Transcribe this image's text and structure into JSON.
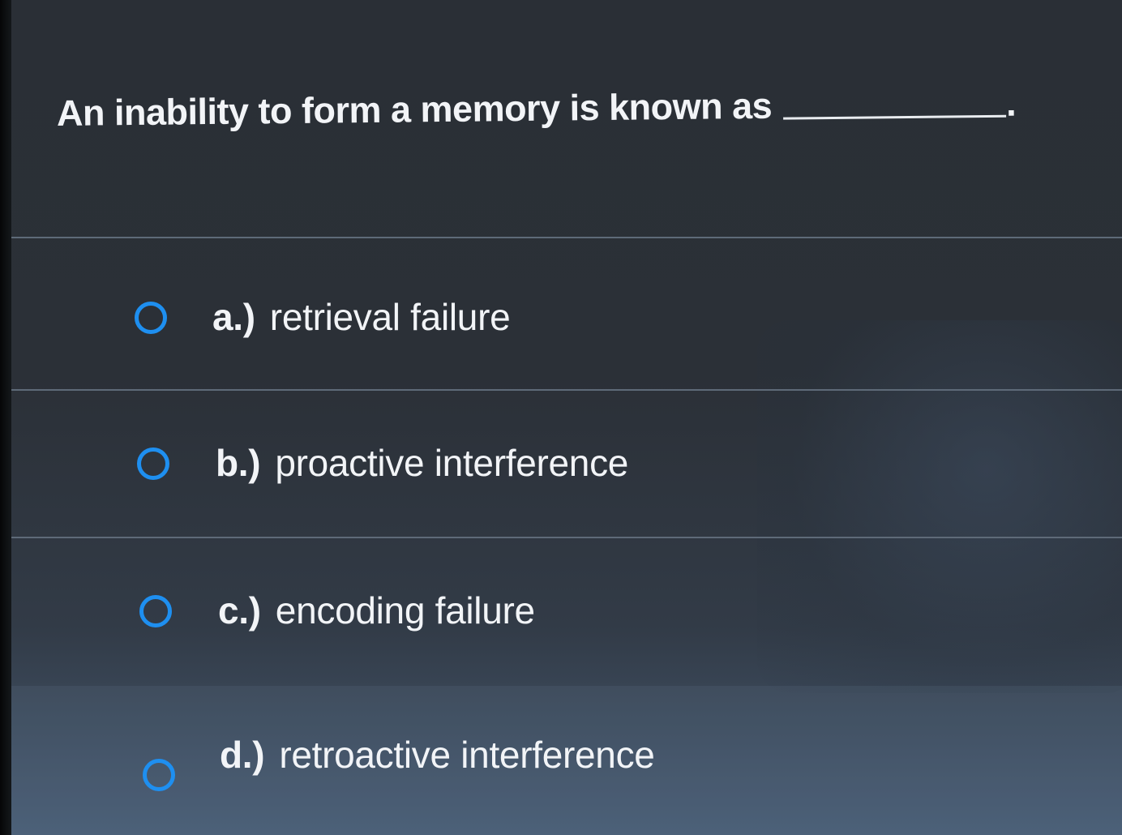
{
  "question": {
    "text": "An inability to form a memory is known as",
    "period": "."
  },
  "options": [
    {
      "letter": "a.)",
      "label": "retrieval failure",
      "selected": false
    },
    {
      "letter": "b.)",
      "label": "proactive interference",
      "selected": false
    },
    {
      "letter": "c.)",
      "label": "encoding failure",
      "selected": false
    },
    {
      "letter": "d.)",
      "label": "retroactive interference",
      "selected": false
    }
  ],
  "colors": {
    "accent": "#1e8ff0",
    "text": "#f2f4f7",
    "background": "#2b3037"
  },
  "icons": {
    "radio": "radio-button-unselected-icon"
  }
}
